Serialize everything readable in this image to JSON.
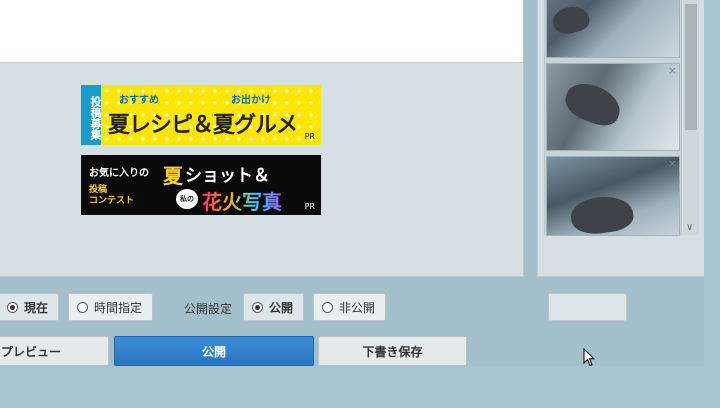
{
  "banners": [
    {
      "stripe": "投稿募集",
      "sub_left": "おすすめ",
      "sub_right": "お出かけ",
      "main": "夏レシピ＆夏グルメ",
      "pr": "PR"
    },
    {
      "line1": "お気に入りの",
      "highlight": "夏",
      "line1b": "ショット＆",
      "contest": "投稿\nコンテスト",
      "bubble": "私の",
      "line2": "花火写真",
      "pr": "PR"
    }
  ],
  "publish_time": {
    "options": [
      {
        "label": "現在",
        "selected": true
      },
      {
        "label": "時間指定",
        "selected": false
      }
    ]
  },
  "publish_setting": {
    "label": "公開設定",
    "options": [
      {
        "label": "公開",
        "selected": true
      },
      {
        "label": "非公開",
        "selected": false
      }
    ]
  },
  "actions": {
    "preview": "プレビュー",
    "publish": "公開",
    "draft": "下書き保存"
  },
  "thumbnails": {
    "close_glyph": "×",
    "scroll_down_glyph": "∨"
  },
  "colors": {
    "primary": "#2a74bd",
    "background": "#a9c4d1",
    "panel": "#d6dfe3"
  }
}
